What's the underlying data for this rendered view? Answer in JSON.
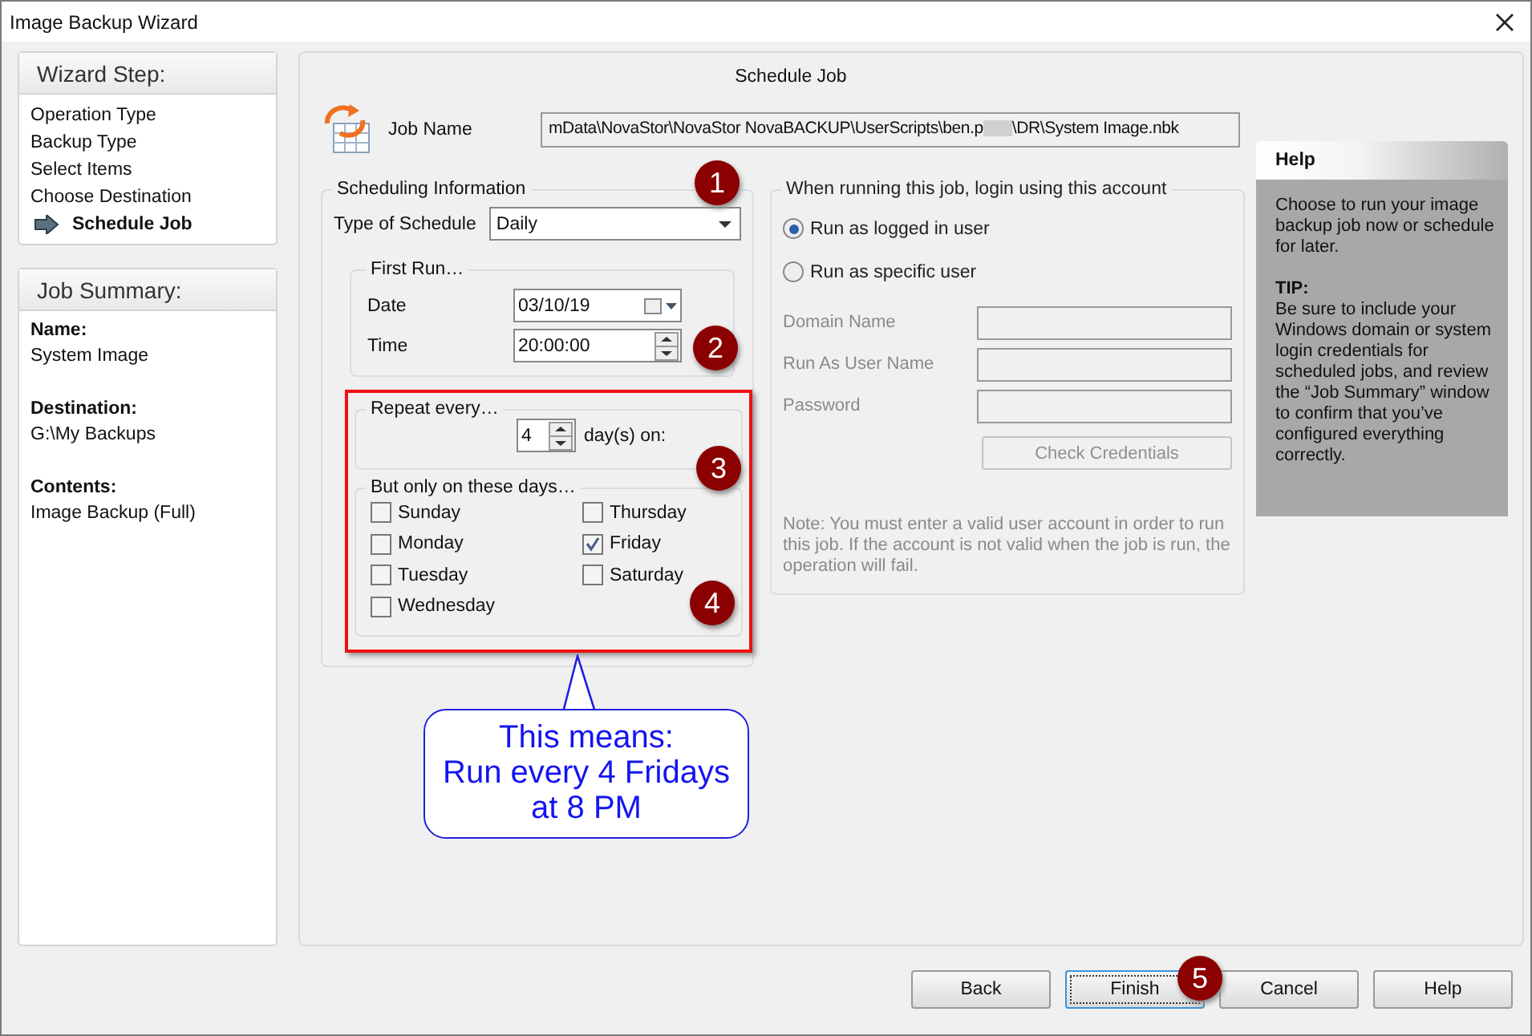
{
  "window": {
    "title": "Image Backup Wizard"
  },
  "wizard_steps": {
    "title": "Wizard Step:",
    "items": [
      {
        "label": "Operation Type",
        "selected": false
      },
      {
        "label": "Backup Type",
        "selected": false
      },
      {
        "label": "Select Items",
        "selected": false
      },
      {
        "label": "Choose Destination",
        "selected": false
      },
      {
        "label": "Schedule Job",
        "selected": true
      }
    ]
  },
  "job_summary": {
    "title": "Job Summary:",
    "fields": [
      {
        "label": "Name:",
        "value": "System Image"
      },
      {
        "label": "Destination:",
        "value": "G:\\My Backups"
      },
      {
        "label": "Contents:",
        "value": "Image Backup (Full)"
      }
    ]
  },
  "page_title": "Schedule Job",
  "job_name": {
    "label": "Job Name",
    "value_start": "mData\\NovaStor\\NovaStor NovaBACKUP\\UserScripts\\ben.p",
    "value_end": "\\DR\\System Image.nbk"
  },
  "scheduling": {
    "title": "Scheduling Information",
    "type_label": "Type of Schedule",
    "type_value": "Daily",
    "first_run": {
      "title": "First Run…",
      "date_label": "Date",
      "date_value": "03/10/19",
      "time_label": "Time",
      "time_value": "20:00:00"
    },
    "repeat": {
      "title": "Repeat every…",
      "value": "4",
      "suffix": "day(s) on:"
    },
    "days": {
      "title": "But only on these days…",
      "items": [
        {
          "label": "Sunday",
          "checked": false
        },
        {
          "label": "Monday",
          "checked": false
        },
        {
          "label": "Tuesday",
          "checked": false
        },
        {
          "label": "Wednesday",
          "checked": false
        },
        {
          "label": "Thursday",
          "checked": false
        },
        {
          "label": "Friday",
          "checked": true
        },
        {
          "label": "Saturday",
          "checked": false
        }
      ]
    }
  },
  "login": {
    "title": "When running this job, login using this account",
    "options": [
      {
        "label": "Run as logged in user",
        "selected": true
      },
      {
        "label": "Run as specific user",
        "selected": false
      }
    ],
    "fields": [
      {
        "label": "Domain Name",
        "disabled": true
      },
      {
        "label": "Run As User Name",
        "disabled": true
      },
      {
        "label": "Password",
        "disabled": true
      }
    ],
    "check_button": {
      "label": "Check Credentials",
      "disabled": true
    },
    "note": "Note: You must enter a valid user account in order to run this job. If the account is not valid when the job is run, the operation will fail."
  },
  "help": {
    "title": "Help",
    "intro": "Choose to run your image backup job now or schedule for later.",
    "tip_title": "TIP:",
    "tip": "Be sure to include your Windows domain or system login credentials for scheduled jobs, and review the “Job Summary” window to confirm that you’ve configured everything correctly."
  },
  "callout": "This means:\nRun every 4 Fridays\nat 8 PM",
  "markers": [
    "1",
    "2",
    "3",
    "4",
    "5"
  ],
  "buttons": [
    {
      "label": "Back",
      "focused": false
    },
    {
      "label": "Finish",
      "focused": true
    },
    {
      "label": "Cancel",
      "focused": false
    },
    {
      "label": "Help",
      "focused": false
    }
  ]
}
